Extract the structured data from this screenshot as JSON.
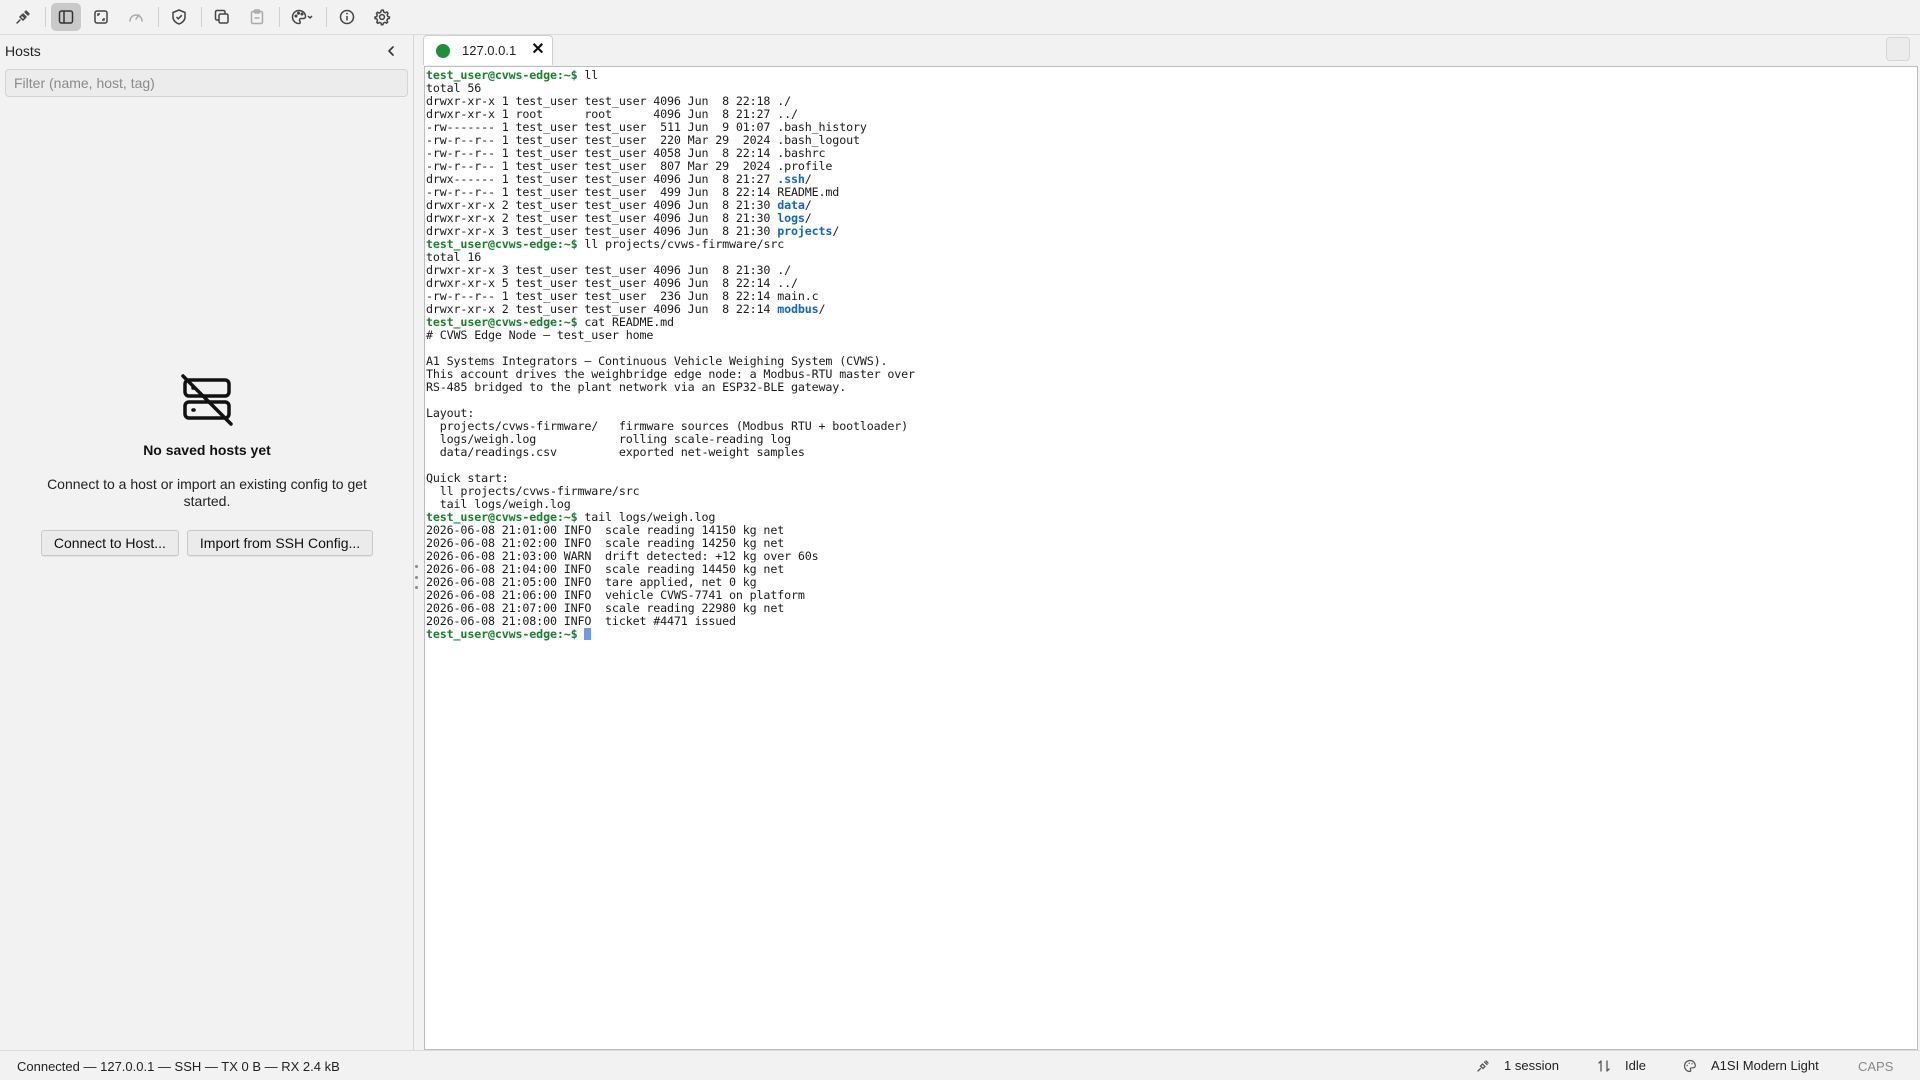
{
  "app": {
    "accent": "#1f8f3a",
    "prompt_color": "#1b7f2d",
    "dir_color": "#1565c0"
  },
  "toolbar": {
    "buttons": [
      {
        "name": "connect-icon",
        "active": false
      },
      {
        "name": "sidebar-toggle-icon",
        "active": true
      },
      {
        "name": "fullscreen-icon",
        "active": false
      },
      {
        "name": "speedometer-icon",
        "active": false
      },
      {
        "name": "shield-icon",
        "active": false
      },
      {
        "name": "duplicate-icon",
        "active": false
      },
      {
        "name": "clipboard-icon",
        "active": false
      },
      {
        "name": "theme-palette-icon",
        "active": false
      },
      {
        "name": "info-icon",
        "active": false
      },
      {
        "name": "settings-gear-icon",
        "active": false
      }
    ]
  },
  "sidebar": {
    "title": "Hosts",
    "filter_placeholder": "Filter (name, host, tag)",
    "filter_value": "",
    "empty": {
      "icon": "server-off-icon",
      "title": "No saved hosts yet",
      "description": "Connect to a host or import an existing config to get started.",
      "connect_label": "Connect to Host...",
      "import_label": "Import from SSH Config..."
    }
  },
  "tabs": [
    {
      "label": "127.0.0.1",
      "status": "connected",
      "status_color": "#1f8f3a",
      "close_symbol": "✕"
    }
  ],
  "terminal": {
    "lines": [
      [
        {
          "c": "p",
          "t": "test_user@cvws-edge:~$"
        },
        {
          "t": " ll"
        }
      ],
      [
        {
          "t": "total 56"
        }
      ],
      [
        {
          "t": "drwxr-xr-x 1 test_user test_user 4096 Jun  8 22:18 ./"
        }
      ],
      [
        {
          "t": "drwxr-xr-x 1 root      root      4096 Jun  8 21:27 ../"
        }
      ],
      [
        {
          "t": "-rw------- 1 test_user test_user  511 Jun  9 01:07 .bash_history"
        }
      ],
      [
        {
          "t": "-rw-r--r-- 1 test_user test_user  220 Mar 29  2024 .bash_logout"
        }
      ],
      [
        {
          "t": "-rw-r--r-- 1 test_user test_user 4058 Jun  8 22:14 .bashrc"
        }
      ],
      [
        {
          "t": "-rw-r--r-- 1 test_user test_user  807 Mar 29  2024 .profile"
        }
      ],
      [
        {
          "t": "drwx------ 1 test_user test_user 4096 Jun  8 21:27 "
        },
        {
          "c": "d",
          "t": ".ssh"
        },
        {
          "t": "/"
        }
      ],
      [
        {
          "t": "-rw-r--r-- 1 test_user test_user  499 Jun  8 22:14 README.md"
        }
      ],
      [
        {
          "t": "drwxr-xr-x 2 test_user test_user 4096 Jun  8 21:30 "
        },
        {
          "c": "d",
          "t": "data"
        },
        {
          "t": "/"
        }
      ],
      [
        {
          "t": "drwxr-xr-x 2 test_user test_user 4096 Jun  8 21:30 "
        },
        {
          "c": "d",
          "t": "logs"
        },
        {
          "t": "/"
        }
      ],
      [
        {
          "t": "drwxr-xr-x 3 test_user test_user 4096 Jun  8 21:30 "
        },
        {
          "c": "d",
          "t": "projects"
        },
        {
          "t": "/"
        }
      ],
      [
        {
          "c": "p",
          "t": "test_user@cvws-edge:~$"
        },
        {
          "t": " ll projects/cvws-firmware/src"
        }
      ],
      [
        {
          "t": "total 16"
        }
      ],
      [
        {
          "t": "drwxr-xr-x 3 test_user test_user 4096 Jun  8 21:30 ./"
        }
      ],
      [
        {
          "t": "drwxr-xr-x 5 test_user test_user 4096 Jun  8 22:14 ../"
        }
      ],
      [
        {
          "t": "-rw-r--r-- 1 test_user test_user  236 Jun  8 22:14 main.c"
        }
      ],
      [
        {
          "t": "drwxr-xr-x 2 test_user test_user 4096 Jun  8 22:14 "
        },
        {
          "c": "d",
          "t": "modbus"
        },
        {
          "t": "/"
        }
      ],
      [
        {
          "c": "p",
          "t": "test_user@cvws-edge:~$"
        },
        {
          "t": " cat README.md"
        }
      ],
      [
        {
          "t": "# CVWS Edge Node — test_user home"
        }
      ],
      [
        {
          "t": ""
        }
      ],
      [
        {
          "t": "A1 Systems Integrators — Continuous Vehicle Weighing System (CVWS)."
        }
      ],
      [
        {
          "t": "This account drives the weighbridge edge node: a Modbus-RTU master over"
        }
      ],
      [
        {
          "t": "RS-485 bridged to the plant network via an ESP32-BLE gateway."
        }
      ],
      [
        {
          "t": ""
        }
      ],
      [
        {
          "t": "Layout:"
        }
      ],
      [
        {
          "t": "  projects/cvws-firmware/   firmware sources (Modbus RTU + bootloader)"
        }
      ],
      [
        {
          "t": "  logs/weigh.log            rolling scale-reading log"
        }
      ],
      [
        {
          "t": "  data/readings.csv         exported net-weight samples"
        }
      ],
      [
        {
          "t": ""
        }
      ],
      [
        {
          "t": "Quick start:"
        }
      ],
      [
        {
          "t": "  ll projects/cvws-firmware/src"
        }
      ],
      [
        {
          "t": "  tail logs/weigh.log"
        }
      ],
      [
        {
          "c": "p",
          "t": "test_user@cvws-edge:~$"
        },
        {
          "t": " tail logs/weigh.log"
        }
      ],
      [
        {
          "t": "2026-06-08 21:01:00 INFO  scale reading 14150 kg net"
        }
      ],
      [
        {
          "t": "2026-06-08 21:02:00 INFO  scale reading 14250 kg net"
        }
      ],
      [
        {
          "t": "2026-06-08 21:03:00 WARN  drift detected: +12 kg over 60s"
        }
      ],
      [
        {
          "t": "2026-06-08 21:04:00 INFO  scale reading 14450 kg net"
        }
      ],
      [
        {
          "t": "2026-06-08 21:05:00 INFO  tare applied, net 0 kg"
        }
      ],
      [
        {
          "t": "2026-06-08 21:06:00 INFO  vehicle CVWS-7741 on platform"
        }
      ],
      [
        {
          "t": "2026-06-08 21:07:00 INFO  scale reading 22980 kg net"
        }
      ],
      [
        {
          "t": "2026-06-08 21:08:00 INFO  ticket #4471 issued"
        }
      ],
      [
        {
          "c": "p",
          "t": "test_user@cvws-edge:~$"
        },
        {
          "t": " "
        },
        {
          "c": "cursor",
          "t": ""
        }
      ]
    ]
  },
  "statusbar": {
    "connection": "Connected — 127.0.0.1 — SSH — TX 0 B — RX 2.4 kB",
    "sessions_icon": "plug-icon",
    "sessions": "1 session",
    "activity_icon": "transfer-arrows-icon",
    "activity": "Idle",
    "theme_icon": "palette-icon",
    "theme": "A1SI Modern Light",
    "caps": "CAPS"
  }
}
